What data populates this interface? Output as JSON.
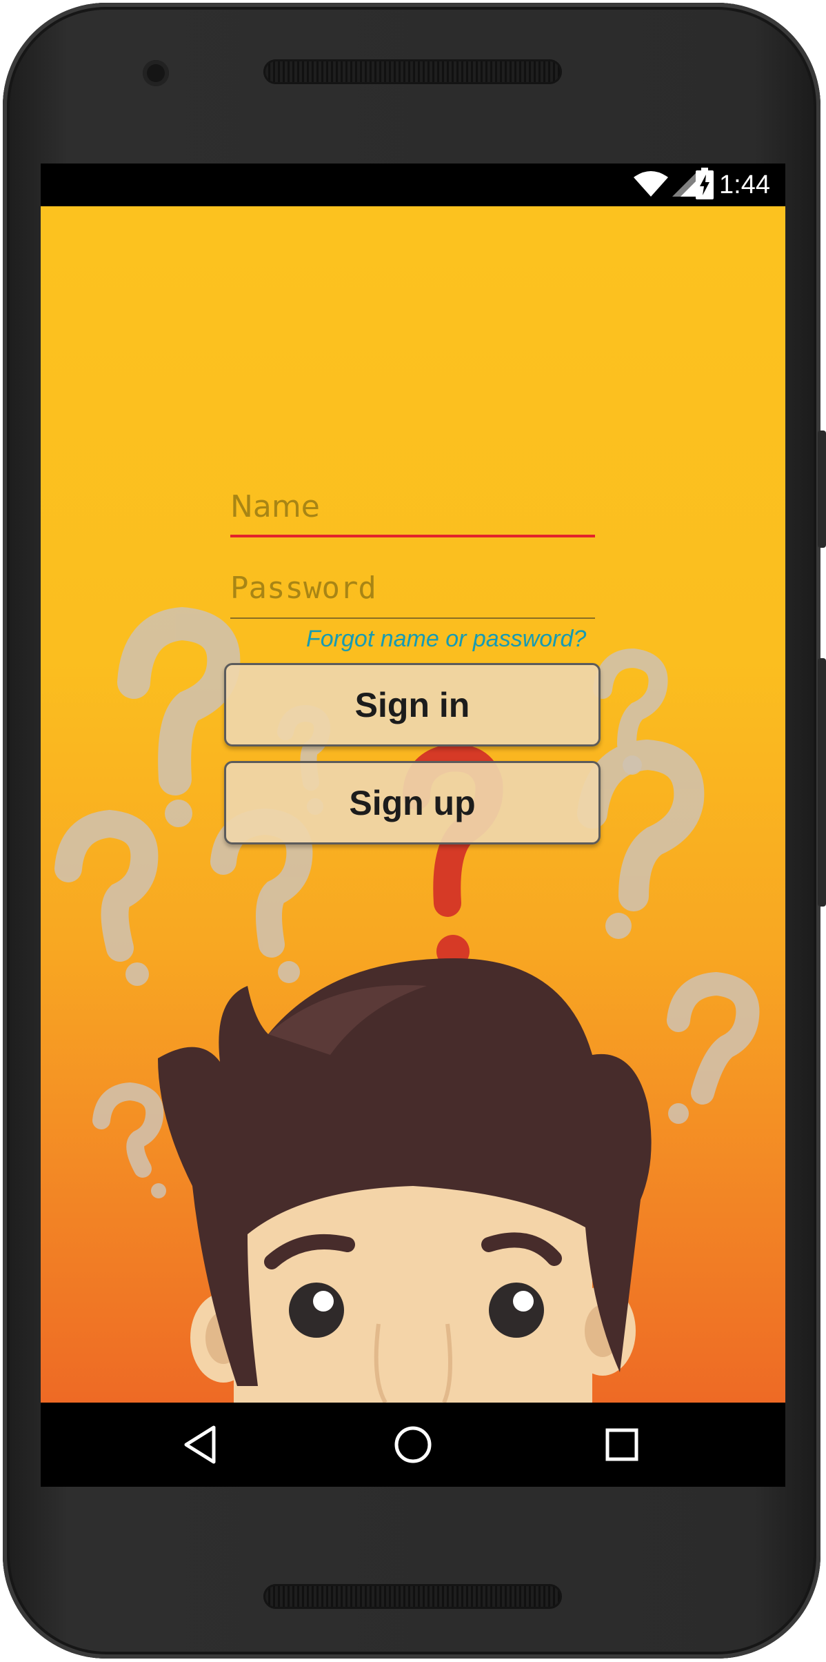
{
  "status_bar": {
    "time": "1:44",
    "icons": [
      "wifi-icon",
      "signal-icon",
      "battery-charging-icon"
    ]
  },
  "login_form": {
    "name_placeholder": "Name",
    "password_placeholder": "Password",
    "forgot_link": "Forgot name or password?",
    "sign_in_label": "Sign in",
    "sign_up_label": "Sign up"
  },
  "nav_bar": {
    "buttons": [
      "back-icon",
      "home-icon",
      "recents-icon"
    ]
  },
  "colors": {
    "background_top": "#fcc21f",
    "background_bottom": "#ee6a25",
    "focused_underline": "#e3232b",
    "link": "#179bb3",
    "button_fill": "#efd6aa"
  }
}
